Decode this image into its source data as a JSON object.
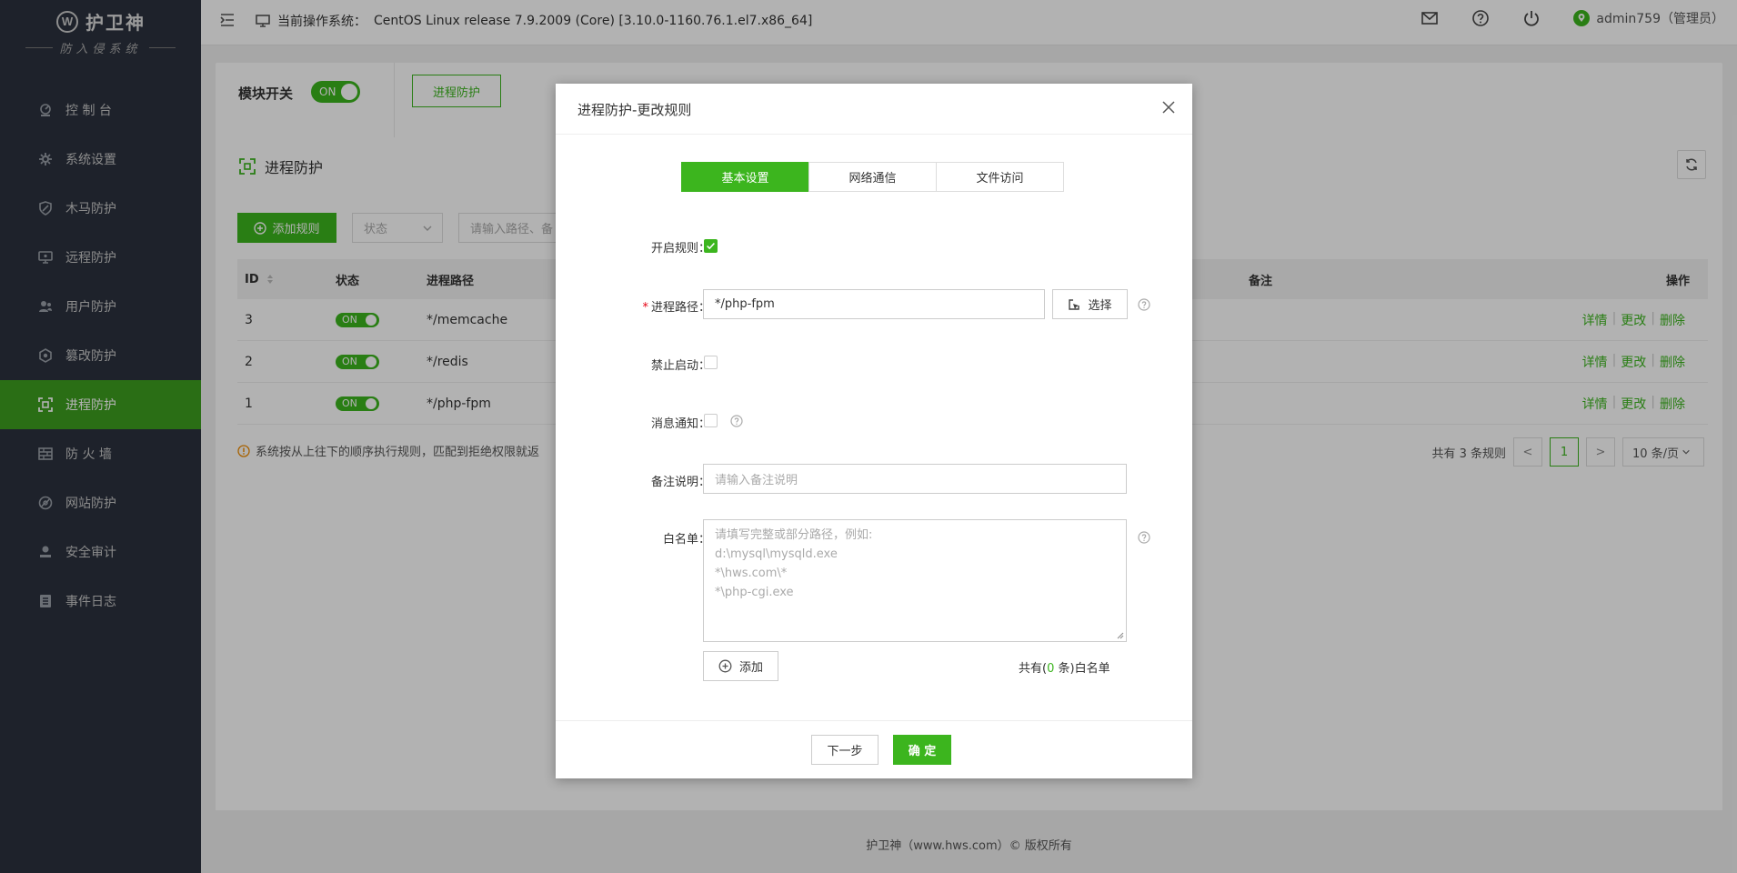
{
  "brand": {
    "name": "护卫神",
    "subtitle": "防入侵系统",
    "logo_letter": "W"
  },
  "sidebar": {
    "items": [
      {
        "label": "控 制 台",
        "icon": "dashboard-icon"
      },
      {
        "label": "系统设置",
        "icon": "gear-icon"
      },
      {
        "label": "木马防护",
        "icon": "shield-icon"
      },
      {
        "label": "远程防护",
        "icon": "monitor-icon"
      },
      {
        "label": "用户防护",
        "icon": "users-icon"
      },
      {
        "label": "篡改防护",
        "icon": "hexagon-shield-icon"
      },
      {
        "label": "进程防护",
        "icon": "process-icon",
        "active": true
      },
      {
        "label": "防 火 墙",
        "icon": "firewall-icon"
      },
      {
        "label": "网站防护",
        "icon": "globe-icon"
      },
      {
        "label": "安全审计",
        "icon": "audit-icon"
      },
      {
        "label": "事件日志",
        "icon": "log-icon"
      }
    ]
  },
  "topbar": {
    "os_label": "当前操作系统：",
    "os_value": "CentOS Linux release 7.9.2009 (Core) [3.10.0-1160.76.1.el7.x86_64]",
    "user": "admin759（管理员）"
  },
  "module": {
    "label": "模块开关",
    "toggle": "ON",
    "tab": "进程防护"
  },
  "page": {
    "title": "进程防护",
    "add_rule": "添加规则",
    "status_placeholder": "状态",
    "search_placeholder": "请输入路径、备"
  },
  "table": {
    "headers": {
      "id": "ID",
      "status": "状态",
      "path": "进程路径",
      "note": "备注",
      "ops": "操作"
    },
    "rows": [
      {
        "id": "3",
        "status": "ON",
        "path": "*/memcache"
      },
      {
        "id": "2",
        "status": "ON",
        "path": "*/redis"
      },
      {
        "id": "1",
        "status": "ON",
        "path": "*/php-fpm"
      }
    ],
    "op_labels": {
      "detail": "详情",
      "edit": "更改",
      "delete": "删除"
    }
  },
  "hint": "系统按从上往下的顺序执行规则，匹配到拒绝权限就返",
  "pager": {
    "total": "共有 3 条规则",
    "prev": "<",
    "page": "1",
    "next": ">",
    "size": "10 条/页"
  },
  "footer": "护卫神（www.hws.com）© 版权所有",
  "modal": {
    "title": "进程防护-更改规则",
    "tabs": [
      "基本设置",
      "网络通信",
      "文件访问"
    ],
    "fields": {
      "enable_label": "开启规则：",
      "path_label": "进程路径：",
      "path_value": "*/php-fpm",
      "select_btn": "选择",
      "forbid_label": "禁止启动：",
      "notify_label": "消息通知：",
      "remark_label": "备注说明：",
      "remark_placeholder": "请输入备注说明",
      "whitelist_label": "白名单：",
      "whitelist_placeholder": [
        "请填写完整或部分路径，例如:",
        "d:\\mysql\\mysqld.exe",
        "*\\hws.com\\*",
        "*\\php-cgi.exe"
      ],
      "add_btn": "添加",
      "count_prefix": "共有(",
      "count_value": "0",
      "count_suffix": " 条)白名单"
    },
    "next_btn": "下一步",
    "ok_btn": "确 定"
  }
}
